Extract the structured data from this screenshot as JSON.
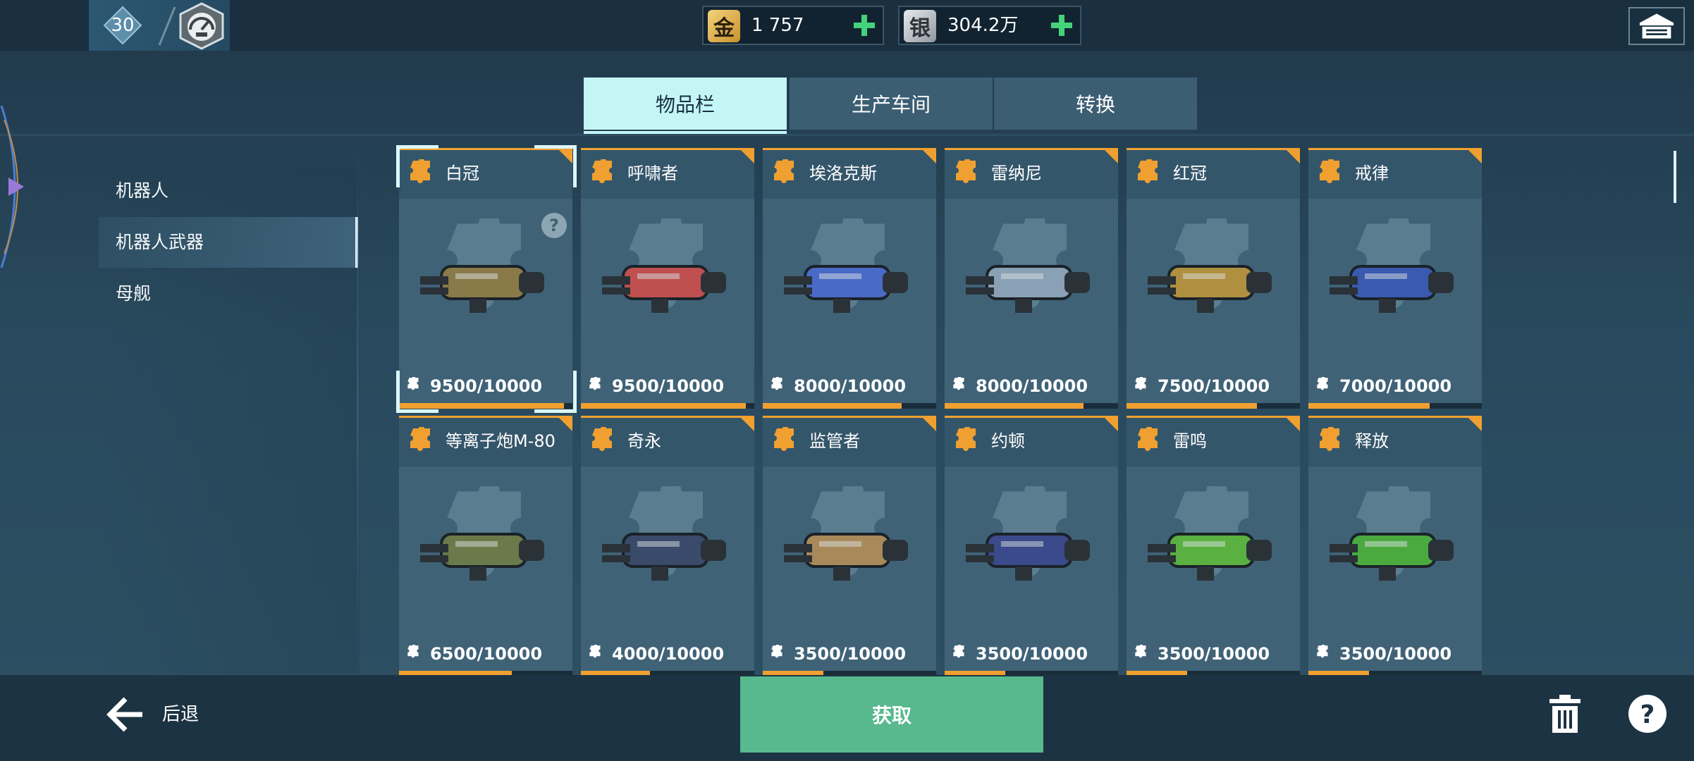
{
  "topbar": {
    "level": "30",
    "rank_icon": "speedometer-badge-icon",
    "gold": {
      "label": "金",
      "value": "1 757"
    },
    "silver": {
      "label": "银",
      "value": "304.2万"
    },
    "garage_icon": "hangar-icon"
  },
  "tabs": [
    {
      "label": "物品栏",
      "active": true
    },
    {
      "label": "生产车间",
      "active": false
    },
    {
      "label": "转换",
      "active": false
    }
  ],
  "sidebar": {
    "items": [
      {
        "label": "机器人",
        "selected": false
      },
      {
        "label": "机器人武器",
        "selected": true
      },
      {
        "label": "母舰",
        "selected": false
      }
    ]
  },
  "cards": [
    {
      "name": "白冠",
      "count": "9500/10000",
      "progress": 0.95,
      "selected": true
    },
    {
      "name": "呼啸者",
      "count": "9500/10000",
      "progress": 0.95
    },
    {
      "name": "埃洛克斯",
      "count": "8000/10000",
      "progress": 0.8
    },
    {
      "name": "雷纳尼",
      "count": "8000/10000",
      "progress": 0.8
    },
    {
      "name": "红冠",
      "count": "7500/10000",
      "progress": 0.75
    },
    {
      "name": "戒律",
      "count": "7000/10000",
      "progress": 0.7
    },
    {
      "name": "等离子炮M-80",
      "count": "6500/10000",
      "progress": 0.65
    },
    {
      "name": "奇永",
      "count": "4000/10000",
      "progress": 0.4
    },
    {
      "name": "监管者",
      "count": "3500/10000",
      "progress": 0.35
    },
    {
      "name": "约顿",
      "count": "3500/10000",
      "progress": 0.35
    },
    {
      "name": "雷鸣",
      "count": "3500/10000",
      "progress": 0.35
    },
    {
      "name": "释放",
      "count": "3500/10000",
      "progress": 0.35
    }
  ],
  "bottom": {
    "back_label": "后退",
    "acquire_label": "获取",
    "trash_icon": "trash-icon",
    "help_icon": "help-icon"
  },
  "colors": {
    "accent_orange": "#f0a030",
    "tab_active": "#c5f6f6",
    "acquire_green": "#58b98e"
  }
}
